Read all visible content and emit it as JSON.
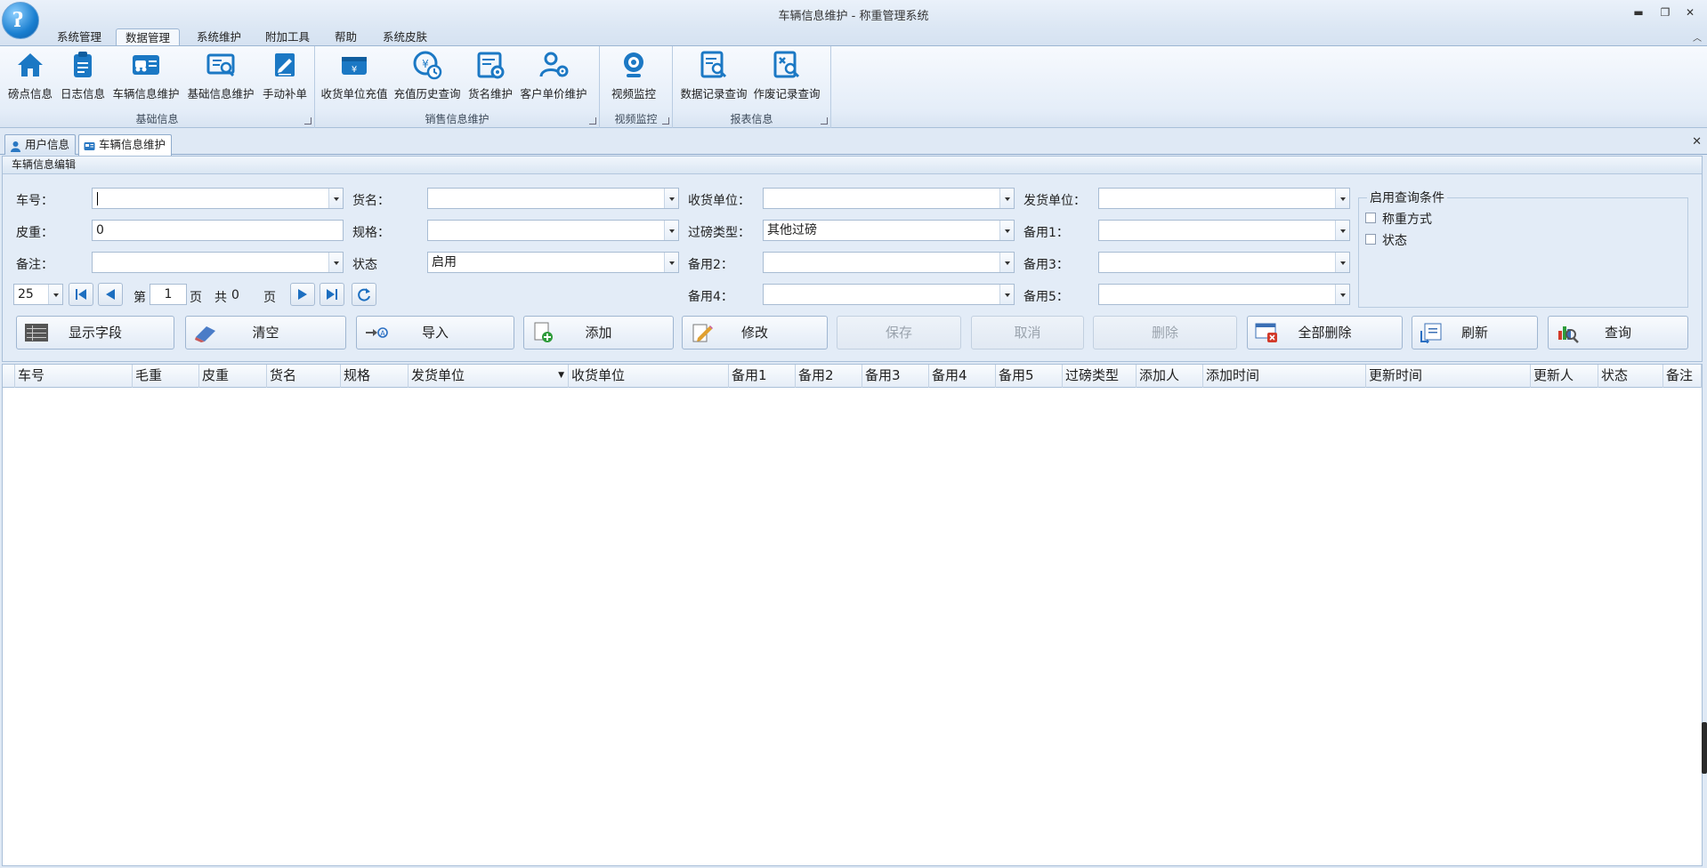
{
  "window": {
    "title": "车辆信息维护 - 称重管理系统"
  },
  "menu": {
    "tabs": [
      {
        "label": "系统管理"
      },
      {
        "label": "数据管理"
      },
      {
        "label": "系统维护"
      },
      {
        "label": "附加工具"
      },
      {
        "label": "帮助"
      },
      {
        "label": "系统皮肤"
      }
    ],
    "active": "数据管理"
  },
  "ribbon": {
    "groups": [
      {
        "label": "基础信息",
        "buttons": [
          {
            "label": "磅点信息",
            "icon": "home-icon"
          },
          {
            "label": "日志信息",
            "icon": "clipboard-icon"
          },
          {
            "label": "车辆信息维护",
            "icon": "vehicle-card-icon"
          },
          {
            "label": "基础信息维护",
            "icon": "list-search-icon"
          },
          {
            "label": "手动补单",
            "icon": "edit-document-icon"
          }
        ]
      },
      {
        "label": "销售信息维护",
        "buttons": [
          {
            "label": "收货单位充值",
            "icon": "wallet-icon"
          },
          {
            "label": "充值历史查询",
            "icon": "coin-clock-icon"
          },
          {
            "label": "货名维护",
            "icon": "list-gear-icon"
          },
          {
            "label": "客户单价维护",
            "icon": "user-gear-icon"
          }
        ]
      },
      {
        "label": "视频监控",
        "buttons": [
          {
            "label": "视频监控",
            "icon": "webcam-icon"
          }
        ]
      },
      {
        "label": "报表信息",
        "buttons": [
          {
            "label": "数据记录查询",
            "icon": "report-search-icon"
          },
          {
            "label": "作废记录查询",
            "icon": "report-void-icon"
          }
        ]
      }
    ]
  },
  "doc_tabs": [
    {
      "label": "用户信息"
    },
    {
      "label": "车辆信息维护"
    }
  ],
  "panel": {
    "title": "车辆信息编辑",
    "fields": {
      "plate": {
        "label": "车号：",
        "value": ""
      },
      "goods": {
        "label": "货名：",
        "value": ""
      },
      "receiver": {
        "label": "收货单位：",
        "value": ""
      },
      "sender": {
        "label": "发货单位：",
        "value": ""
      },
      "tare": {
        "label": "皮重：",
        "value": "0"
      },
      "spec": {
        "label": "规格：",
        "value": ""
      },
      "weigh_type": {
        "label": "过磅类型：",
        "value": "其他过磅"
      },
      "spare1": {
        "label": "备用1：",
        "value": ""
      },
      "remark": {
        "label": "备注：",
        "value": ""
      },
      "status": {
        "label": "状态",
        "value": "启用"
      },
      "spare2": {
        "label": "备用2：",
        "value": ""
      },
      "spare3": {
        "label": "备用3：",
        "value": ""
      },
      "spare4": {
        "label": "备用4：",
        "value": ""
      },
      "spare5": {
        "label": "备用5：",
        "value": ""
      }
    },
    "query_conditions": {
      "legend": "启用查询条件",
      "options": [
        {
          "label": "称重方式",
          "checked": false
        },
        {
          "label": "状态",
          "checked": false
        }
      ]
    },
    "pager": {
      "page_size": "25",
      "page_prefix": "第",
      "page": "1",
      "page_suffix": "页",
      "total_prefix": "共",
      "total": "0",
      "total_suffix": "页"
    },
    "actions": [
      {
        "label": "显示字段",
        "enabled": true
      },
      {
        "label": "清空",
        "enabled": true
      },
      {
        "label": "导入",
        "enabled": true
      },
      {
        "label": "添加",
        "enabled": true
      },
      {
        "label": "修改",
        "enabled": true
      },
      {
        "label": "保存",
        "enabled": false
      },
      {
        "label": "取消",
        "enabled": false
      },
      {
        "label": "删除",
        "enabled": false
      },
      {
        "label": "全部删除",
        "enabled": true
      },
      {
        "label": "刷新",
        "enabled": true
      },
      {
        "label": "查询",
        "enabled": true
      }
    ]
  },
  "grid": {
    "columns": [
      "车号",
      "毛重",
      "皮重",
      "货名",
      "规格",
      "发货单位",
      "收货单位",
      "备用1",
      "备用2",
      "备用3",
      "备用4",
      "备用5",
      "过磅类型",
      "添加人",
      "添加时间",
      "更新时间",
      "更新人",
      "状态",
      "备注"
    ],
    "rows": []
  }
}
